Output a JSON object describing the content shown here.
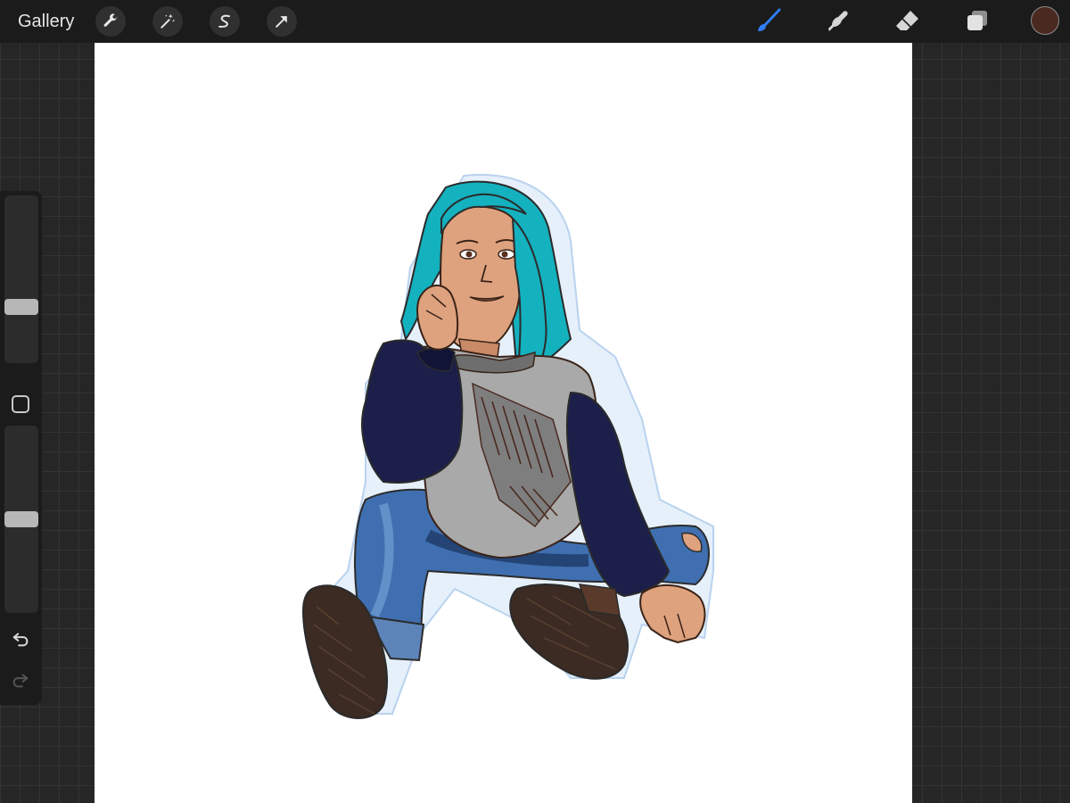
{
  "topbar": {
    "gallery_label": "Gallery",
    "left_tools": [
      "wrench-icon",
      "magic-wand-icon",
      "selection-icon",
      "transform-arrow-icon"
    ],
    "right_tools": [
      "brush-icon",
      "smudge-icon",
      "eraser-icon",
      "layers-icon"
    ],
    "active_tool": "brush-icon",
    "current_color": "#4a2a20",
    "active_tool_color": "#2f7cf6"
  },
  "sidebar": {
    "brush_size_level": 0.32,
    "opacity_level": 0.5,
    "undo_icon": "undo-icon",
    "redo_icon": "redo-icon"
  },
  "canvas": {
    "background": "#ffffff",
    "artwork": "girl-sitting-illustration"
  }
}
